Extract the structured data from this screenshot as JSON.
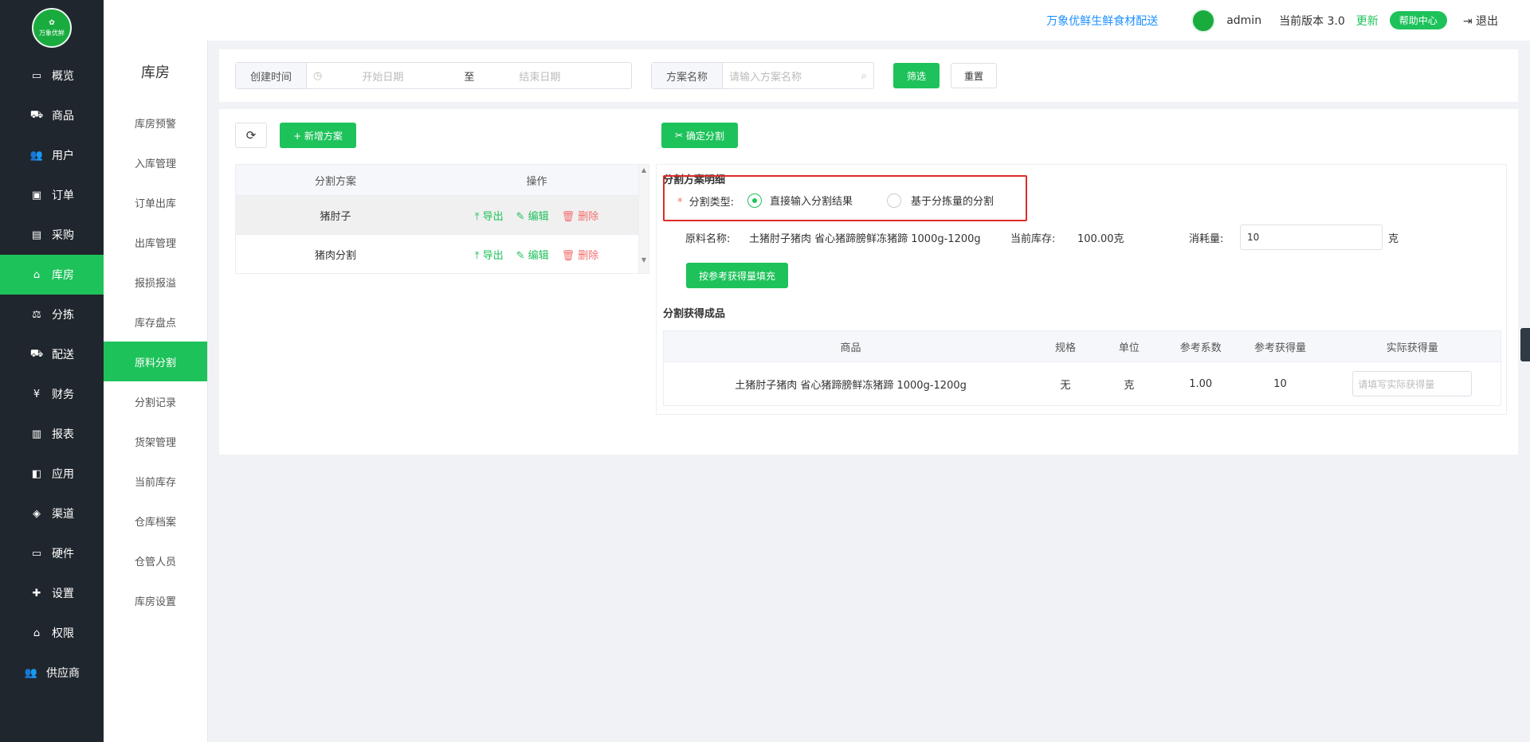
{
  "sidebar": {
    "logo_text": "万象优鲜",
    "items": [
      {
        "label": "概览",
        "icon": "monitor-icon",
        "glyph": "▭",
        "active": false
      },
      {
        "label": "商品",
        "icon": "cart-icon",
        "glyph": "⛟",
        "active": false
      },
      {
        "label": "用户",
        "icon": "users-icon",
        "glyph": "👥",
        "active": false
      },
      {
        "label": "订单",
        "icon": "money-icon",
        "glyph": "▣",
        "active": false
      },
      {
        "label": "采购",
        "icon": "train-icon",
        "glyph": "▤",
        "active": false
      },
      {
        "label": "库房",
        "icon": "home-icon",
        "glyph": "⌂",
        "active": true
      },
      {
        "label": "分拣",
        "icon": "scale-icon",
        "glyph": "⚖",
        "active": false
      },
      {
        "label": "配送",
        "icon": "truck-icon",
        "glyph": "⛟",
        "active": false
      },
      {
        "label": "财务",
        "icon": "yen-icon",
        "glyph": "¥",
        "active": false
      },
      {
        "label": "报表",
        "icon": "bar-chart-icon",
        "glyph": "▥",
        "active": false
      },
      {
        "label": "应用",
        "icon": "apps-icon",
        "glyph": "◧",
        "active": false
      },
      {
        "label": "渠道",
        "icon": "cube-icon",
        "glyph": "◈",
        "active": false
      },
      {
        "label": "硬件",
        "icon": "desktop-icon",
        "glyph": "▭",
        "active": false
      },
      {
        "label": "设置",
        "icon": "puzzle-icon",
        "glyph": "✚",
        "active": false
      },
      {
        "label": "权限",
        "icon": "bank-icon",
        "glyph": "⌂",
        "active": false
      },
      {
        "label": "供应商",
        "icon": "group-icon",
        "glyph": "👥",
        "active": false
      }
    ]
  },
  "subbar": {
    "title": "库房",
    "items": [
      {
        "label": "库房预警",
        "active": false
      },
      {
        "label": "入库管理",
        "active": false
      },
      {
        "label": "订单出库",
        "active": false
      },
      {
        "label": "出库管理",
        "active": false
      },
      {
        "label": "报损报溢",
        "active": false
      },
      {
        "label": "库存盘点",
        "active": false
      },
      {
        "label": "原料分割",
        "active": true
      },
      {
        "label": "分割记录",
        "active": false
      },
      {
        "label": "货架管理",
        "active": false
      },
      {
        "label": "当前库存",
        "active": false
      },
      {
        "label": "仓库档案",
        "active": false
      },
      {
        "label": "仓管人员",
        "active": false
      },
      {
        "label": "库房设置",
        "active": false
      }
    ]
  },
  "topbar": {
    "brand": "万象优鲜生鲜食材配送",
    "username": "admin",
    "version_label": "当前版本 3.0",
    "update_label": "更新",
    "help_label": "帮助中心",
    "logout_label": "退出"
  },
  "filter": {
    "created_label": "创建时间",
    "start_placeholder": "开始日期",
    "to_label": "至",
    "end_placeholder": "结束日期",
    "plan_label": "方案名称",
    "plan_placeholder": "请输入方案名称",
    "filter_btn": "筛选",
    "reset_btn": "重置"
  },
  "toolbar": {
    "add_plan": "+ 新增方案",
    "confirm_split": "确定分割"
  },
  "plan_table": {
    "col_plan": "分割方案",
    "col_ops": "操作",
    "rows": [
      {
        "name": "猪肘子",
        "export": "导出",
        "edit": "编辑",
        "delete": "删除"
      },
      {
        "name": "猪肉分割",
        "export": "导出",
        "edit": "编辑",
        "delete": "删除"
      }
    ]
  },
  "detail": {
    "title": "分割方案明细",
    "type_label": "分割类型:",
    "required_mark": "*",
    "option_direct": "直接输入分割结果",
    "option_sorting": "基于分拣量的分割",
    "material_label": "原料名称:",
    "material_value": "土猪肘子猪肉 省心猪蹄膀鲜冻猪蹄 1000g-1200g",
    "stock_label": "当前库存:",
    "stock_value": "100.00克",
    "consume_label": "消耗量:",
    "consume_value": "10",
    "consume_unit": "克",
    "fill_btn": "按参考获得量填充",
    "result_title": "分割获得成品"
  },
  "result_table": {
    "headers": [
      "商品",
      "规格",
      "单位",
      "参考系数",
      "参考获得量",
      "实际获得量"
    ],
    "rows": [
      {
        "product": "土猪肘子猪肉 省心猪蹄膀鲜冻猪蹄 1000g-1200g",
        "spec": "无",
        "unit": "克",
        "coef": "1.00",
        "ref": "10",
        "actual_placeholder": "请填写实际获得量"
      }
    ]
  }
}
